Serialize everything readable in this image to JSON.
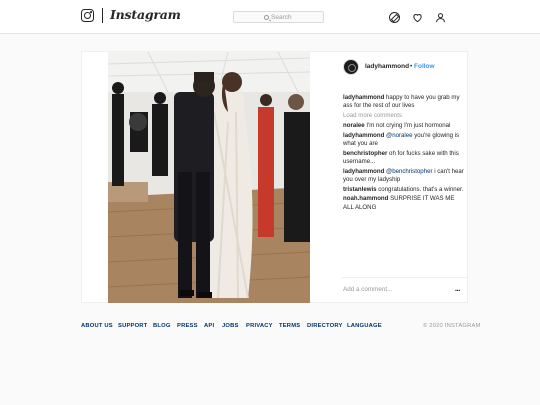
{
  "header": {
    "wordmark": "Instagram",
    "search": {
      "placeholder": "Search"
    },
    "icons": [
      "compass-icon",
      "heart-icon",
      "person-icon"
    ]
  },
  "post": {
    "image_alt": "Wedding couple kissing",
    "header": {
      "username": "ladyhammond",
      "separator": "•",
      "follow_label": "Follow"
    },
    "caption": {
      "username": "ladyhammond",
      "text": " happy to have you grab my ass for the rest of our lives"
    },
    "load_more": "Load more comments",
    "comments": [
      {
        "username": "noralee",
        "mention": "",
        "text": " I'm not crying I'm just hormonal"
      },
      {
        "username": "ladyhammond",
        "mention": " @noralee",
        "text": " you're glowing is what you are"
      },
      {
        "username": "benchristopher",
        "mention": "",
        "text": " oh for fucks sake with this username..."
      },
      {
        "username": "ladyhammond",
        "mention": " @benchristopher",
        "text": " i can't hear you over my ladyship"
      },
      {
        "username": "tristanlewis",
        "mention": "",
        "text": " congratulations. that's a winner."
      },
      {
        "username": "noah.hammond",
        "mention": "",
        "text": " SURPRISE IT WAS ME ALL ALONG"
      }
    ],
    "add_comment_placeholder": "Add a comment...",
    "more_options": "..."
  },
  "footer": {
    "links": [
      "ABOUT US",
      "SUPPORT",
      "BLOG",
      "PRESS",
      "API",
      "JOBS",
      "PRIVACY",
      "TERMS",
      "DIRECTORY",
      "LANGUAGE"
    ],
    "copyright": "© 2020 INSTAGRAM"
  },
  "colors": {
    "link_blue": "#3897f0",
    "dark_link": "#003569",
    "muted": "#999999",
    "text": "#262626"
  }
}
